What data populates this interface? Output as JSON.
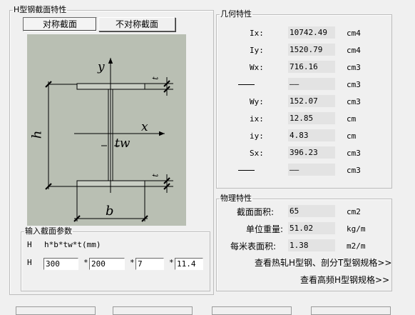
{
  "section": {
    "title": "H型钢截面特性"
  },
  "tabs": {
    "symmetric": "对称截面",
    "asymmetric": "不对称截面"
  },
  "diagram": {
    "y": "y",
    "x": "x",
    "h": "h",
    "b": "b",
    "tw": "tw",
    "t": "t"
  },
  "input": {
    "title": "输入截面参数",
    "prefix": "H",
    "formula": "h*b*tw*t(mm)",
    "times": "*",
    "h": "300",
    "b": "200",
    "tw": "7",
    "t": "11.4"
  },
  "geometry": {
    "title": "几何特性",
    "rows": [
      {
        "label": "Ix:",
        "value": "10742.49",
        "unit": "cm4"
      },
      {
        "label": "Iy:",
        "value": "1520.79",
        "unit": "cm4"
      },
      {
        "label": "Wx:",
        "value": "716.16",
        "unit": "cm3"
      },
      {
        "label": "——",
        "value": "——",
        "unit": "cm3"
      },
      {
        "label": "Wy:",
        "value": "152.07",
        "unit": "cm3"
      },
      {
        "label": "ix:",
        "value": "12.85",
        "unit": "cm"
      },
      {
        "label": "iy:",
        "value": "4.83",
        "unit": "cm"
      },
      {
        "label": "Sx:",
        "value": "396.23",
        "unit": "cm3"
      },
      {
        "label": "——",
        "value": "——",
        "unit": "cm3"
      }
    ]
  },
  "physical": {
    "title": "物理特性",
    "rows": [
      {
        "label": "截面面积:",
        "value": "65",
        "unit": "cm2"
      },
      {
        "label": "单位重量:",
        "value": "51.02",
        "unit": "kg/m"
      },
      {
        "label": "每米表面积:",
        "value": "1.38",
        "unit": "m2/m"
      }
    ],
    "link_hot": "查看热轧H型钢、剖分T型钢规格>>",
    "link_hf": "查看高频H型钢规格>>"
  }
}
